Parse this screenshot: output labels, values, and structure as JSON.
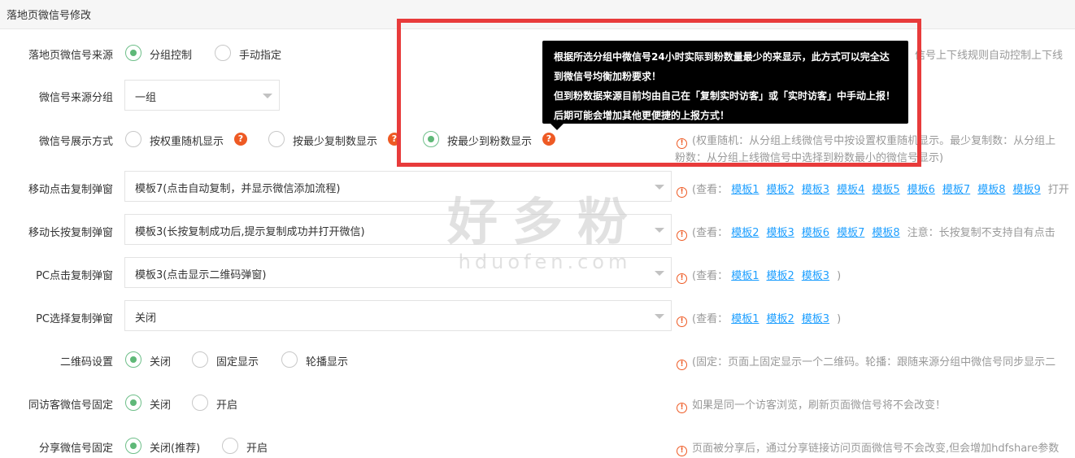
{
  "header": {
    "title": "落地页微信号修改"
  },
  "rows": {
    "source": {
      "label": "落地页微信号来源",
      "options": [
        "分组控制",
        "手动指定"
      ],
      "tip": "信号上下线规则自动控制上下线"
    },
    "group": {
      "label": "微信号来源分组",
      "value": "一组"
    },
    "display": {
      "label": "微信号展示方式",
      "options": [
        "按权重随机显示",
        "按最少复制数显示",
        "按最少到粉数显示"
      ],
      "tip_line1": "(权重随机：从分组上线微信号中按设置权重随机显示。最少复制数：从分组上",
      "tip_line2": "粉数：从分组上线微信号中选择到粉数最小的微信号显示)"
    },
    "mobile_click": {
      "label": "移动点击复制弹窗",
      "value": "模板7(点击自动复制，并显示微信添加流程)",
      "tip_prefix": "(查看：",
      "links": [
        "模板1",
        "模板2",
        "模板3",
        "模板4",
        "模板5",
        "模板6",
        "模板7",
        "模板8",
        "模板9"
      ],
      "tip_suffix": "打开"
    },
    "mobile_long": {
      "label": "移动长按复制弹窗",
      "value": "模板3(长按复制成功后,提示复制成功并打开微信)",
      "tip_prefix": "(查看：",
      "links": [
        "模板2",
        "模板3",
        "模板6",
        "模板7",
        "模板8"
      ],
      "tip_suffix": "注意：长按复制不支持自有点击"
    },
    "pc_click": {
      "label": "PC点击复制弹窗",
      "value": "模板3(点击显示二维码弹窗)",
      "tip_prefix": "(查看：",
      "links": [
        "模板1",
        "模板2",
        "模板3"
      ],
      "tip_suffix": ")"
    },
    "pc_select": {
      "label": "PC选择复制弹窗",
      "value": "关闭",
      "tip_prefix": "(查看：",
      "links": [
        "模板1",
        "模板2",
        "模板3"
      ],
      "tip_suffix": ")"
    },
    "qrcode": {
      "label": "二维码设置",
      "options": [
        "关闭",
        "固定显示",
        "轮播显示"
      ],
      "tip": "(固定：页面上固定显示一个二维码。轮播：跟随来源分组中微信号同步显示二"
    },
    "visitor": {
      "label": "同访客微信号固定",
      "options": [
        "关闭",
        "开启"
      ],
      "tip": "如果是同一个访客浏览，刷新页面微信号将不会改变！"
    },
    "share": {
      "label": "分享微信号固定",
      "options": [
        "关闭(推荐)",
        "开启"
      ],
      "tip": "页面被分享后，通过分享链接访问页面微信号不会改变,但会增加hdfshare参数"
    }
  },
  "tooltip": {
    "line1": "根据所选分组中微信号24小时实际到粉数量最少的来显示，此方式可以完全达",
    "line2": "到微信号均衡加粉要求！",
    "line3": "但到粉数据来源目前均由自己在「复制实时访客」或「实时访客」中手动上报！",
    "line4": "后期可能会增加其他更便捷的上报方式！"
  },
  "watermark": {
    "big": "好多粉",
    "small": "hduofen.com"
  },
  "icons": {
    "question": "?",
    "info": "!"
  },
  "colors": {
    "accent": "#5fb878",
    "link": "#1e9fff",
    "warn": "#ee5a24",
    "highlight": "#e83b3b"
  }
}
